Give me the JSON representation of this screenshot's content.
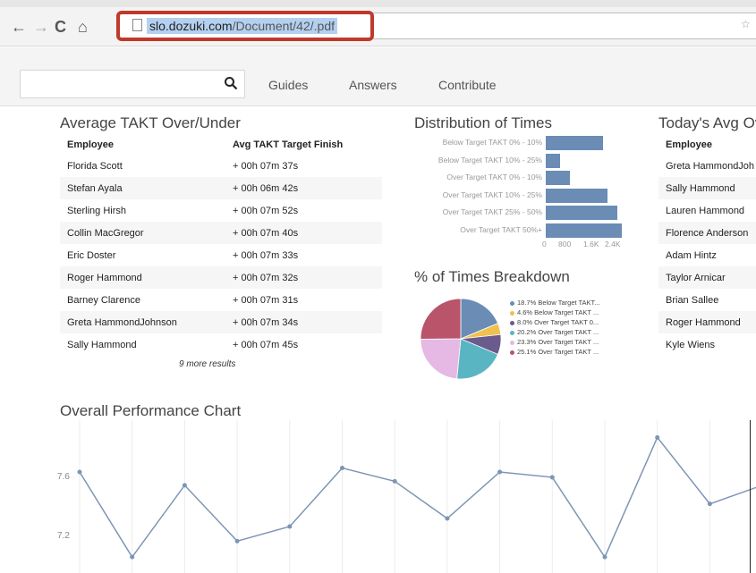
{
  "browser": {
    "url_domain": "slo.dozuki.com",
    "url_path": "/Document/42/.pdf"
  },
  "header": {
    "search_placeholder": "",
    "nav": [
      "Guides",
      "Answers",
      "Contribute"
    ]
  },
  "takt_panel": {
    "title": "Average TAKT Over/Under",
    "columns": [
      "Employee",
      "Avg TAKT Target Finish"
    ],
    "rows": [
      [
        "Florida Scott",
        "+ 00h 07m 37s"
      ],
      [
        "Stefan Ayala",
        "+ 00h 06m 42s"
      ],
      [
        "Sterling Hirsh",
        "+ 00h 07m 52s"
      ],
      [
        "Collin MacGregor",
        "+ 00h 07m 40s"
      ],
      [
        "Eric Doster",
        "+ 00h 07m 33s"
      ],
      [
        "Roger Hammond",
        "+ 00h 07m 32s"
      ],
      [
        "Barney Clarence",
        "+ 00h 07m 31s"
      ],
      [
        "Greta HammondJohnson",
        "+ 00h 07m 34s"
      ],
      [
        "Sally Hammond",
        "+ 00h 07m 45s"
      ]
    ],
    "more": "9 more results"
  },
  "today_panel": {
    "title": "Today's Avg Ov",
    "column": "Employee",
    "rows": [
      "Greta HammondJoh",
      "Sally Hammond",
      "Lauren Hammond",
      "Florence Anderson",
      "Adam Hintz",
      "Taylor Arnicar",
      "Brian Sallee",
      "Roger Hammond",
      "Kyle Wiens"
    ]
  },
  "distribution": {
    "title": "Distribution of Times",
    "categories": [
      "Below Target TAKT 0% - 10%",
      "Below Target TAKT 10% - 25%",
      "Over Target TAKT 0% - 10%",
      "Over Target TAKT 10% - 25%",
      "Over Target TAKT 25% - 50%",
      "Over Target TAKT 50%+"
    ],
    "values": [
      1500,
      370,
      630,
      1620,
      1880,
      2000
    ],
    "max": 2000,
    "ticks": [
      "0",
      "800",
      "1.6K",
      "2.4K"
    ],
    "color": "#6a8cb5"
  },
  "breakdown": {
    "title": "% of Times Breakdown",
    "legend": [
      "18.7% Below Target TAKT...",
      "4.6% Below Target TAKT ...",
      "8.0% Over Target TAKT 0...",
      "20.2% Over Target TAKT ...",
      "23.3% Over Target TAKT ...",
      "25.1% Over Target TAKT ..."
    ],
    "values": [
      18.7,
      4.6,
      8.0,
      20.2,
      23.3,
      25.1
    ],
    "colors": [
      "#6a8cb5",
      "#f0c050",
      "#6b5a8c",
      "#5ab5c2",
      "#e5b9e4",
      "#b9546b"
    ]
  },
  "performance": {
    "title": "Overall Performance Chart",
    "y_ticks": [
      "7.6",
      "7.2"
    ],
    "color": "#7d95b5"
  },
  "chart_data": {
    "type": "line",
    "title": "Overall Performance Chart",
    "xlabel": "",
    "ylabel": "",
    "ylim": [
      6.85,
      8.0
    ],
    "y_ticks": [
      7.2,
      7.6
    ],
    "series": [
      {
        "values": [
          7.61,
          6.97,
          7.51,
          7.09,
          7.2,
          7.64,
          7.54,
          7.26,
          7.61,
          7.57,
          6.97,
          7.87,
          7.37,
          7.51
        ]
      }
    ]
  }
}
